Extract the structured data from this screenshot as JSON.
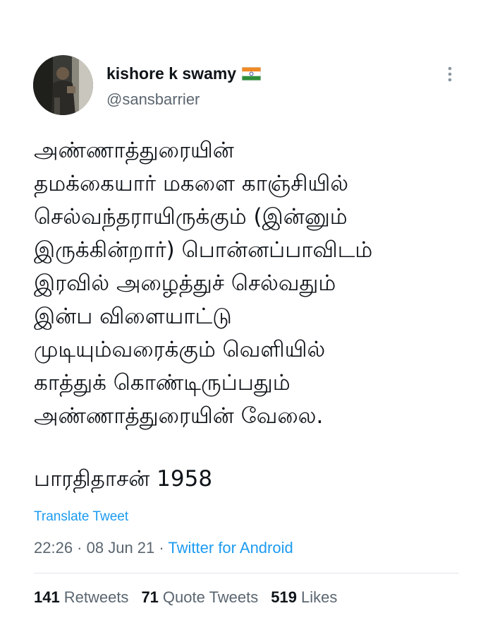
{
  "author": {
    "display_name": "kishore k swamy",
    "flag_icon": "india-flag-icon",
    "handle": "@sansbarrier"
  },
  "tweet": {
    "lines": [
      "அண்ணாத்துரையின்",
      "தமக்கையார் மகளை காஞ்சியில்",
      "செல்வந்தராயிருக்கும் (இன்னும்",
      "இருக்கின்றார்) பொன்னப்பாவிடம்",
      "இரவில் அழைத்துச் செல்வதும்",
      "இன்ப விளையாட்டு",
      "முடியும்வரைக்கும் வெளியில்",
      "காத்துக் கொண்டிருப்பதும்",
      "அண்ணாத்துரையின் வேலை."
    ],
    "signature": "பாரதிதாசன் 1958",
    "translate_label": "Translate Tweet",
    "time": "22:26",
    "date": "08 Jun 21",
    "separator": " · ",
    "source": "Twitter for Android"
  },
  "stats": {
    "retweets_count": "141",
    "retweets_label": "Retweets",
    "quote_tweets_count": "71",
    "quote_tweets_label": "Quote Tweets",
    "likes_count": "519",
    "likes_label": "Likes"
  },
  "colors": {
    "link": "#1d9bf0",
    "secondary_text": "#5b6670",
    "primary_text": "#0f1419"
  },
  "icons": {
    "more": "more-vertical-icon"
  }
}
